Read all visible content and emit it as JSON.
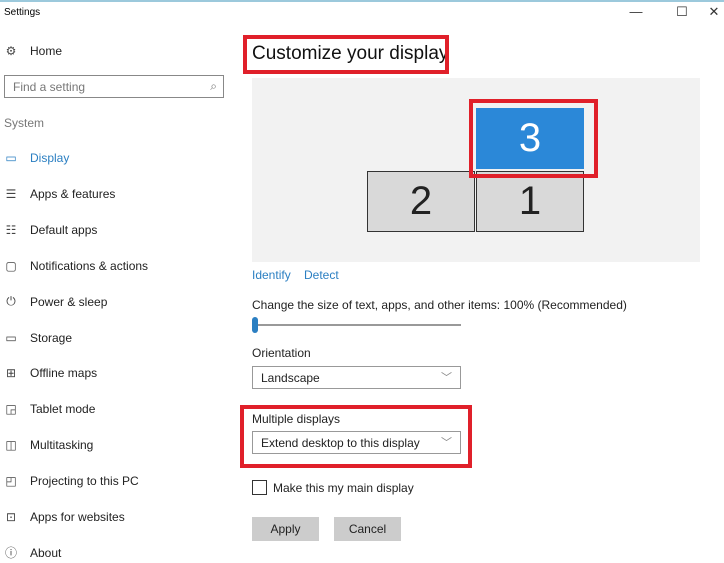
{
  "window": {
    "title": "Settings",
    "controls": [
      "—",
      "☐",
      "✕"
    ]
  },
  "sidebar": {
    "home": {
      "label": "Home",
      "icon": "gear-icon"
    },
    "search": {
      "placeholder": "Find a setting"
    },
    "section": "System",
    "items": [
      {
        "label": "Display",
        "icon": "monitor-icon",
        "glyph": "▭",
        "active": true
      },
      {
        "label": "Apps & features",
        "icon": "list-icon",
        "glyph": "☰"
      },
      {
        "label": "Default apps",
        "icon": "default-apps-icon",
        "glyph": "☷"
      },
      {
        "label": "Notifications & actions",
        "icon": "notification-icon",
        "glyph": "▢"
      },
      {
        "label": "Power & sleep",
        "icon": "power-icon",
        "glyph": "⏻"
      },
      {
        "label": "Storage",
        "icon": "storage-icon",
        "glyph": "▭"
      },
      {
        "label": "Offline maps",
        "icon": "map-icon",
        "glyph": "⊞"
      },
      {
        "label": "Tablet mode",
        "icon": "tablet-icon",
        "glyph": "◲"
      },
      {
        "label": "Multitasking",
        "icon": "multitasking-icon",
        "glyph": "◫"
      },
      {
        "label": "Projecting to this PC",
        "icon": "projecting-icon",
        "glyph": "◰"
      },
      {
        "label": "Apps for websites",
        "icon": "apps-websites-icon",
        "glyph": "⊡"
      },
      {
        "label": "About",
        "icon": "info-icon",
        "glyph": "ⓘ"
      }
    ]
  },
  "main": {
    "title": "Customize your display",
    "monitors": [
      {
        "label": "3",
        "selected": true
      },
      {
        "label": "2"
      },
      {
        "label": "1"
      }
    ],
    "identify": "Identify",
    "detect": "Detect",
    "scale_label": "Change the size of text, apps, and other items: 100% (Recommended)",
    "scale_slider_fraction": 0,
    "orientation_label": "Orientation",
    "orientation_value": "Landscape",
    "multiple_label": "Multiple displays",
    "multiple_value": "Extend desktop to this display",
    "main_display_label": "Make this my main display",
    "main_display_checked": false,
    "apply": "Apply",
    "cancel": "Cancel"
  },
  "colors": {
    "accent": "#2b7fc2",
    "selected_monitor": "#2b88d8",
    "highlight": "#e0202a"
  }
}
